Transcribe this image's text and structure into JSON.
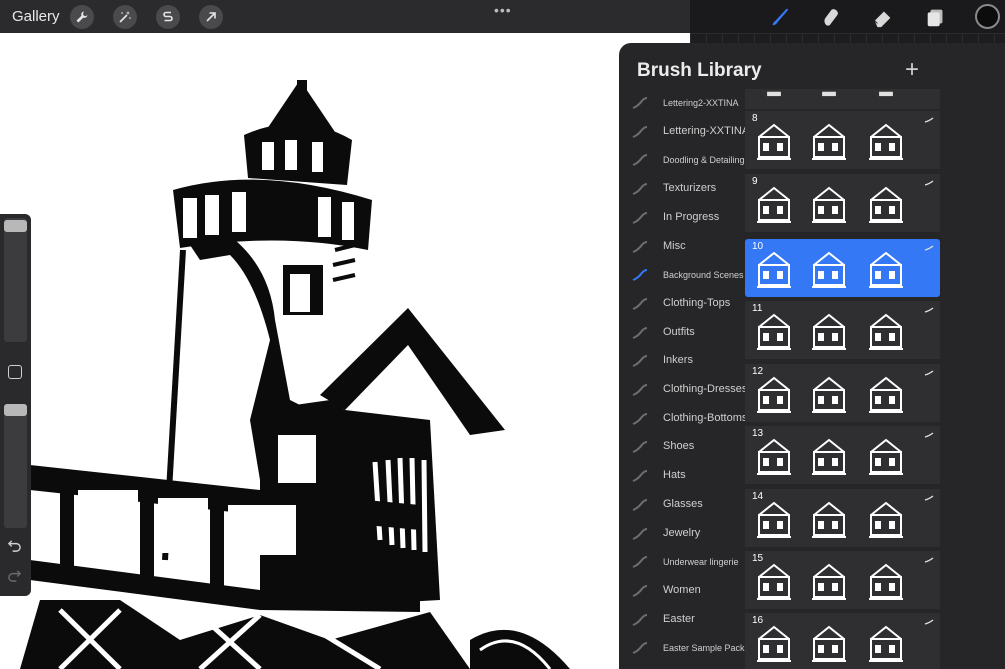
{
  "topbar": {
    "gallery_label": "Gallery",
    "left_tools": [
      "wrench-icon",
      "magic-wand-icon",
      "selection-icon",
      "transform-arrow-icon"
    ],
    "more_dots": "•••",
    "right_tools": [
      "brush-icon",
      "smudge-icon",
      "eraser-icon",
      "layers-icon"
    ],
    "current_color": "#0c0c0c"
  },
  "panel": {
    "title": "Brush Library",
    "add_label": "+",
    "accent": "#3478f6",
    "sets": [
      {
        "label": "Lettering2-XXTINA",
        "small": true
      },
      {
        "label": "Lettering-XXTINA",
        "small": false
      },
      {
        "label": "Doodling & Detailing",
        "small": true
      },
      {
        "label": "Texturizers",
        "small": false
      },
      {
        "label": "In Progress",
        "small": false
      },
      {
        "label": "Misc",
        "small": false
      },
      {
        "label": "Background Scenes",
        "small": true,
        "active": true
      },
      {
        "label": "Clothing-Tops",
        "small": false
      },
      {
        "label": "Outfits",
        "small": false
      },
      {
        "label": "Inkers",
        "small": false
      },
      {
        "label": "Clothing-Dresses",
        "small": false
      },
      {
        "label": "Clothing-Bottoms",
        "small": false
      },
      {
        "label": "Shoes",
        "small": false
      },
      {
        "label": "Hats",
        "small": false
      },
      {
        "label": "Glasses",
        "small": false
      },
      {
        "label": "Jewelry",
        "small": false
      },
      {
        "label": "Underwear lingerie",
        "small": true
      },
      {
        "label": "Women",
        "small": false
      },
      {
        "label": "Easter",
        "small": false
      },
      {
        "label": "Easter Sample Pack",
        "small": true
      }
    ],
    "brushes": [
      {
        "number": "",
        "selected": false
      },
      {
        "number": "8",
        "selected": false
      },
      {
        "number": "9",
        "selected": false
      },
      {
        "number": "10",
        "selected": true
      },
      {
        "number": "11",
        "selected": false
      },
      {
        "number": "12",
        "selected": false
      },
      {
        "number": "13",
        "selected": false
      },
      {
        "number": "14",
        "selected": false
      },
      {
        "number": "15",
        "selected": false
      },
      {
        "number": "16",
        "selected": false
      }
    ]
  },
  "sidebar": {
    "undo_icon": "undo-icon",
    "redo_icon": "redo-icon",
    "modify_icon": "square-icon"
  }
}
